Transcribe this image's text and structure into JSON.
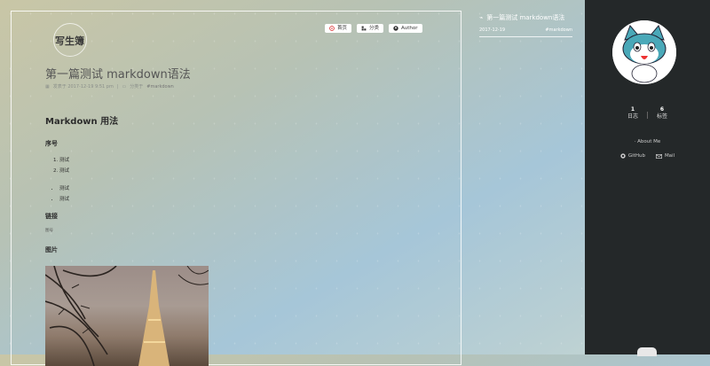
{
  "logo": {
    "text": "写生簿"
  },
  "nav": [
    {
      "label": "首页",
      "icon": "home-icon"
    },
    {
      "label": "分类",
      "icon": "category-icon"
    },
    {
      "label": "Author",
      "icon": "user-icon"
    }
  ],
  "post": {
    "title": "第一篇测试 markdown语法",
    "meta_date": "发表于 2017-12-19 9:51 pm",
    "meta_sep": "|",
    "meta_category_prefix": "分类于",
    "meta_category": "#markdown"
  },
  "content": {
    "h2": "Markdown 用法",
    "section_list_heading": "序号",
    "ordered_items": [
      "测试",
      "测试"
    ],
    "unordered_items": [
      "测试",
      "测试"
    ],
    "section_link_heading": "链接",
    "link_text": "图号",
    "section_image_heading": "图片"
  },
  "toc": {
    "title": "第一篇测试 markdown语法",
    "date": "2017-12-19",
    "tag": "#markdown"
  },
  "sidebar": {
    "stats": [
      {
        "num": "1",
        "label": "日志"
      },
      {
        "num": "6",
        "label": "标签"
      }
    ],
    "about": "About Me",
    "links": [
      {
        "label": "GitHub",
        "icon": "github-icon"
      },
      {
        "label": "Mail",
        "icon": "mail-icon"
      }
    ]
  },
  "colors": {
    "sidebar_bg": "#242829",
    "accent": "#ffffff"
  }
}
